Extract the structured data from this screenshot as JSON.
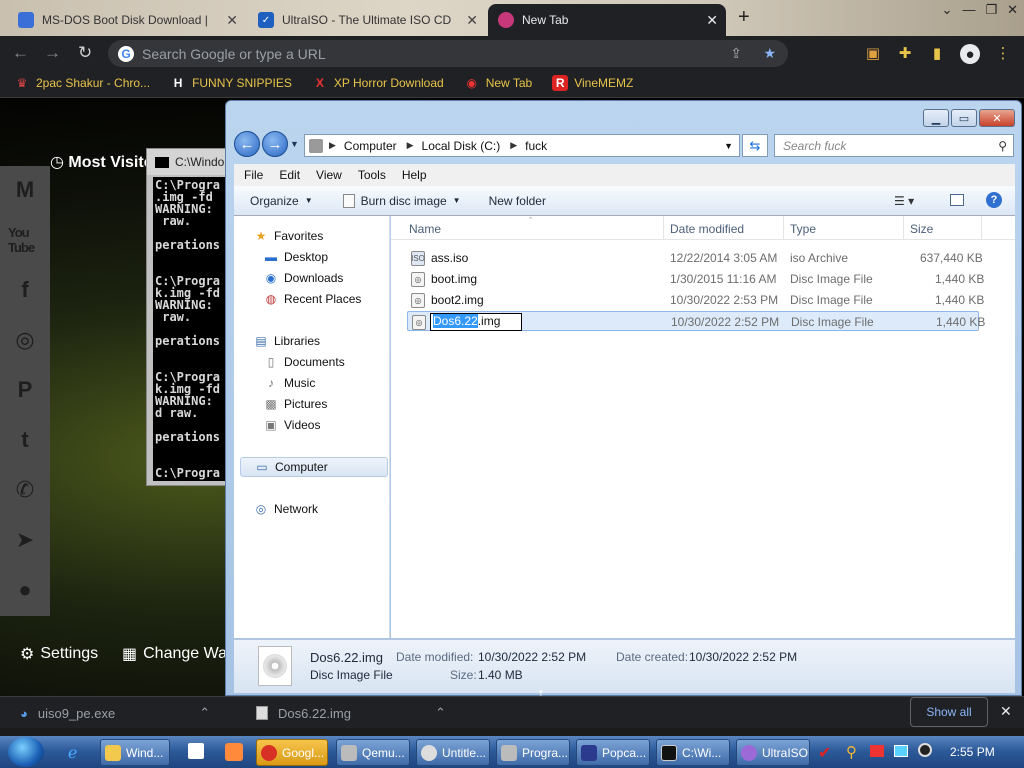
{
  "browser": {
    "tabs": [
      {
        "title": "MS-DOS Boot Disk Download |",
        "close": "✕"
      },
      {
        "title": "UltraISO - The Ultimate ISO CD",
        "close": "✕"
      },
      {
        "title": "New Tab",
        "close": "✕"
      }
    ],
    "new_tab": "+",
    "window_controls": [
      "⌄",
      "—",
      "❐",
      "✕"
    ],
    "omnibox_placeholder": "Search Google or type a URL",
    "bookmarks": [
      {
        "label": "2pac Shakur - Chro...",
        "icon": "bookmark-icon"
      },
      {
        "label": "FUNNY SNIPPIES",
        "icon": "H"
      },
      {
        "label": "XP Horror Download",
        "icon": "X"
      },
      {
        "label": "New Tab",
        "icon": "chrome-icon"
      },
      {
        "label": "VineMEMZ",
        "icon": "R"
      }
    ]
  },
  "ntp": {
    "most_visited": "Most Visite",
    "settings": "Settings",
    "change_wallpaper": "Change Wa",
    "social_icons": [
      "M",
      "You Tube",
      "f",
      "◎",
      "P",
      "t",
      "✆",
      "➤",
      "●"
    ]
  },
  "cmd": {
    "title": "C:\\Windo",
    "output": "C:\\Progra\n.img -fd\nWARNING:\n raw.\n\nperations\n\n\nC:\\Progra\nk.img -fd\nWARNING:\n raw.\n\nperations\n\n\nC:\\Progra\nk.img -fd\nWARNING:\nd raw.\n\nperations\n\n\nC:\\Progra"
  },
  "explorer": {
    "address": [
      "Computer",
      "Local Disk (C:)",
      "fuck"
    ],
    "search_placeholder": "Search fuck",
    "menu": [
      "File",
      "Edit",
      "View",
      "Tools",
      "Help"
    ],
    "commands": [
      "Organize",
      "Burn disc image",
      "New folder"
    ],
    "nav": {
      "favorites": "Favorites",
      "desktop": "Desktop",
      "downloads": "Downloads",
      "recent": "Recent Places",
      "libraries": "Libraries",
      "documents": "Documents",
      "music": "Music",
      "pictures": "Pictures",
      "videos": "Videos",
      "computer": "Computer",
      "network": "Network"
    },
    "columns": {
      "name": "Name",
      "date": "Date modified",
      "type": "Type",
      "size": "Size"
    },
    "files": [
      {
        "name": "ass.iso",
        "date": "12/22/2014 3:05 AM",
        "type": "iso Archive",
        "size": "637,440 KB"
      },
      {
        "name": "boot.img",
        "date": "1/30/2015 11:16 AM",
        "type": "Disc Image File",
        "size": "1,440 KB"
      },
      {
        "name": "boot2.img",
        "date": "10/30/2022 2:53 PM",
        "type": "Disc Image File",
        "size": "1,440 KB"
      },
      {
        "name": "Dos6.22.img",
        "date": "10/30/2022 2:52 PM",
        "type": "Disc Image File",
        "size": "1,440 KB"
      }
    ],
    "rename": {
      "selected": "Dos6.22",
      "rest": ".img"
    },
    "details": {
      "name": "Dos6.22.img",
      "type": "Disc Image File",
      "modified_label": "Date modified:",
      "modified": "10/30/2022 2:52 PM",
      "size_label": "Size:",
      "size": "1.40 MB",
      "created_label": "Date created:",
      "created": "10/30/2022 2:52 PM"
    }
  },
  "downloads": {
    "items": [
      "uiso9_pe.exe",
      "Dos6.22.img"
    ],
    "show_all": "Show all",
    "close": "✕"
  },
  "taskbar": {
    "buttons": [
      "Wind...",
      "Googl...",
      "Qemu...",
      "Untitle...",
      "Progra...",
      "Popca...",
      "C:\\Wi...",
      "UltraISO"
    ],
    "clock": "2:55 PM"
  }
}
